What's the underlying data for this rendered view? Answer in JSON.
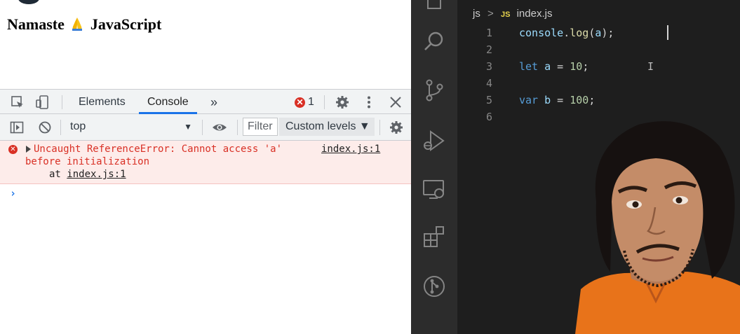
{
  "browser": {
    "heading_left": "Namaste",
    "heading_right": "JavaScript",
    "devtools": {
      "tabs": [
        {
          "label": "Elements",
          "active": false
        },
        {
          "label": "Console",
          "active": true
        }
      ],
      "more_tabs": "»",
      "error_count": "1",
      "context_select": "top",
      "filter_placeholder": "Filter",
      "levels_label": "Custom levels ▼",
      "console": {
        "error_line1": "Uncaught ReferenceError: Cannot access 'a'",
        "error_line2": "before initialization",
        "error_at": "at",
        "error_at_link": "index.js:1",
        "error_source": "index.js:1",
        "prompt": "›"
      }
    }
  },
  "editor": {
    "breadcrumb": {
      "folder": "js",
      "file_icon": "JS",
      "file": "index.js"
    },
    "lines": [
      {
        "num": "1",
        "code": "console.log(a);"
      },
      {
        "num": "2",
        "code": ""
      },
      {
        "num": "3",
        "code": "let a = 10;"
      },
      {
        "num": "4",
        "code": ""
      },
      {
        "num": "5",
        "code": "var b = 100;"
      },
      {
        "num": "6",
        "code": ""
      }
    ],
    "colors": {
      "keyword": "#569cd6",
      "number": "#b5cea8",
      "ident": "#9cdcfe",
      "func": "#dcdcaa"
    }
  }
}
